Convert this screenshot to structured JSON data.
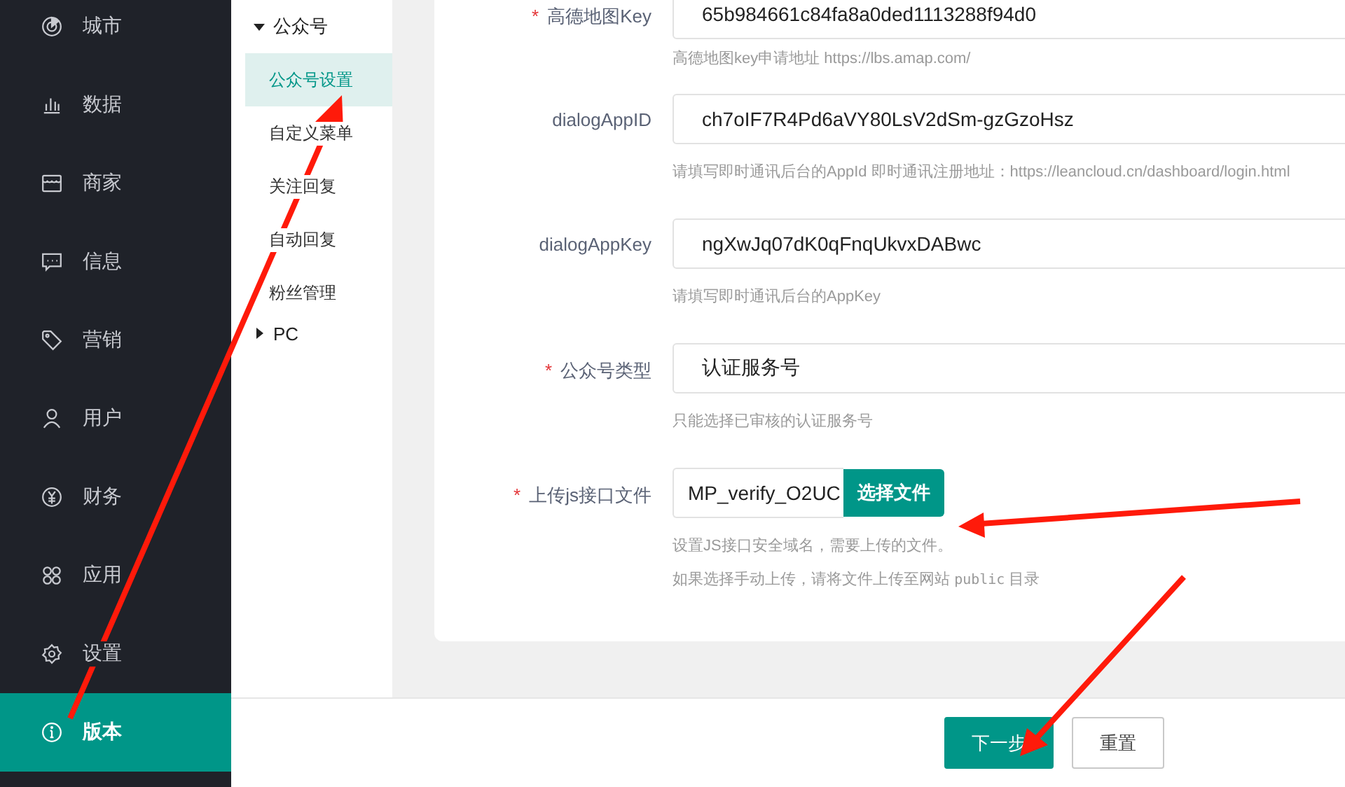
{
  "sidebar": {
    "items": [
      {
        "label": "城市",
        "selected": false
      },
      {
        "label": "数据",
        "selected": false
      },
      {
        "label": "商家",
        "selected": false
      },
      {
        "label": "信息",
        "selected": false
      },
      {
        "label": "营销",
        "selected": false
      },
      {
        "label": "用户",
        "selected": false
      },
      {
        "label": "财务",
        "selected": false
      },
      {
        "label": "应用",
        "selected": false
      },
      {
        "label": "设置",
        "selected": false
      },
      {
        "label": "版本",
        "selected": true
      }
    ]
  },
  "submenu": {
    "groups": [
      {
        "label": "公众号",
        "expanded": true,
        "items": [
          {
            "label": "公众号设置",
            "selected": true
          },
          {
            "label": "自定义菜单",
            "selected": false
          },
          {
            "label": "关注回复",
            "selected": false
          },
          {
            "label": "自动回复",
            "selected": false
          },
          {
            "label": "粉丝管理",
            "selected": false
          }
        ]
      },
      {
        "label": "PC",
        "expanded": false
      }
    ]
  },
  "form": {
    "fields": [
      {
        "kind": "text",
        "label": "高德地图Key",
        "mark": "*",
        "value": "65b984661c84fa8a0ded1113288f94d0",
        "hints": [
          [
            {
              "kind": "plain",
              "text": "高德地图key申请地址 https://lbs.amap.com/"
            }
          ]
        ]
      },
      {
        "kind": "text",
        "label": "dialogAppID",
        "value": "ch7oIF7R4Pd6aVY80LsV2dSm-gzGzoHsz",
        "hints": [
          [
            {
              "kind": "plain",
              "text": "请填写即时通讯后台的AppId 即时通讯注册地址：https://leancloud.cn/dashboard/login.html"
            }
          ]
        ]
      },
      {
        "kind": "text",
        "label": "dialogAppKey",
        "value": "ngXwJq07dK0qFnqUkvxDABwc",
        "hints": [
          [
            {
              "kind": "plain",
              "text": "请填写即时通讯后台的AppKey"
            }
          ]
        ]
      },
      {
        "kind": "text",
        "label": "公众号类型",
        "mark": "*",
        "value": "认证服务号",
        "hints": [
          [
            {
              "kind": "plain",
              "text": "只能选择已审核的认证服务号"
            }
          ]
        ]
      },
      {
        "kind": "file",
        "label": "上传js接口文件",
        "mark": "*",
        "value": "MP_verify_O2UC",
        "button": "选择文件",
        "hints": [
          [
            {
              "kind": "plain",
              "text": "设置JS接口安全域名，需要上传的文件。"
            }
          ],
          [
            {
              "kind": "plain",
              "text": "如果选择手动上传，请将文件上传至网站 "
            },
            {
              "kind": "code",
              "text": "public"
            },
            {
              "kind": "plain",
              "text": " 目录"
            }
          ]
        ]
      }
    ]
  },
  "footer": {
    "buttons": [
      {
        "label": "下一步",
        "kind": "primary"
      },
      {
        "label": "重置",
        "kind": "default"
      }
    ]
  }
}
